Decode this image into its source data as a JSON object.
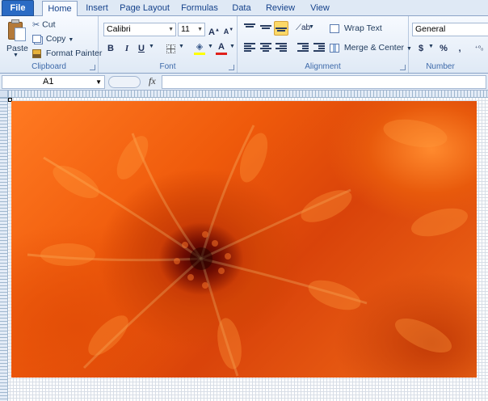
{
  "tabs": [
    {
      "label": "File"
    },
    {
      "label": "Home"
    },
    {
      "label": "Insert"
    },
    {
      "label": "Page Layout"
    },
    {
      "label": "Formulas"
    },
    {
      "label": "Data"
    },
    {
      "label": "Review"
    },
    {
      "label": "View"
    }
  ],
  "active_tab": "Home",
  "clipboard": {
    "group_label": "Clipboard",
    "paste": "Paste",
    "cut": "Cut",
    "copy": "Copy",
    "format_painter": "Format Painter"
  },
  "font": {
    "group_label": "Font",
    "font_name": "Calibri",
    "font_size": "11",
    "bold": "B",
    "italic": "I",
    "underline": "U",
    "font_color_glyph": "A"
  },
  "alignment": {
    "group_label": "Alignment",
    "wrap_text": "Wrap Text",
    "merge_center": "Merge & Center"
  },
  "number": {
    "group_label": "Number",
    "format": "General",
    "currency": "$",
    "percent": "%",
    "comma": ","
  },
  "formula_bar": {
    "name_box": "A1",
    "fx": "fx",
    "value": ""
  },
  "colors": {
    "file_tab": "#2a6bc4",
    "ribbon": "#dfe9f5",
    "highlight": "#fcd867",
    "font_color": "#e0201b",
    "fill_color": "#ffff00"
  }
}
